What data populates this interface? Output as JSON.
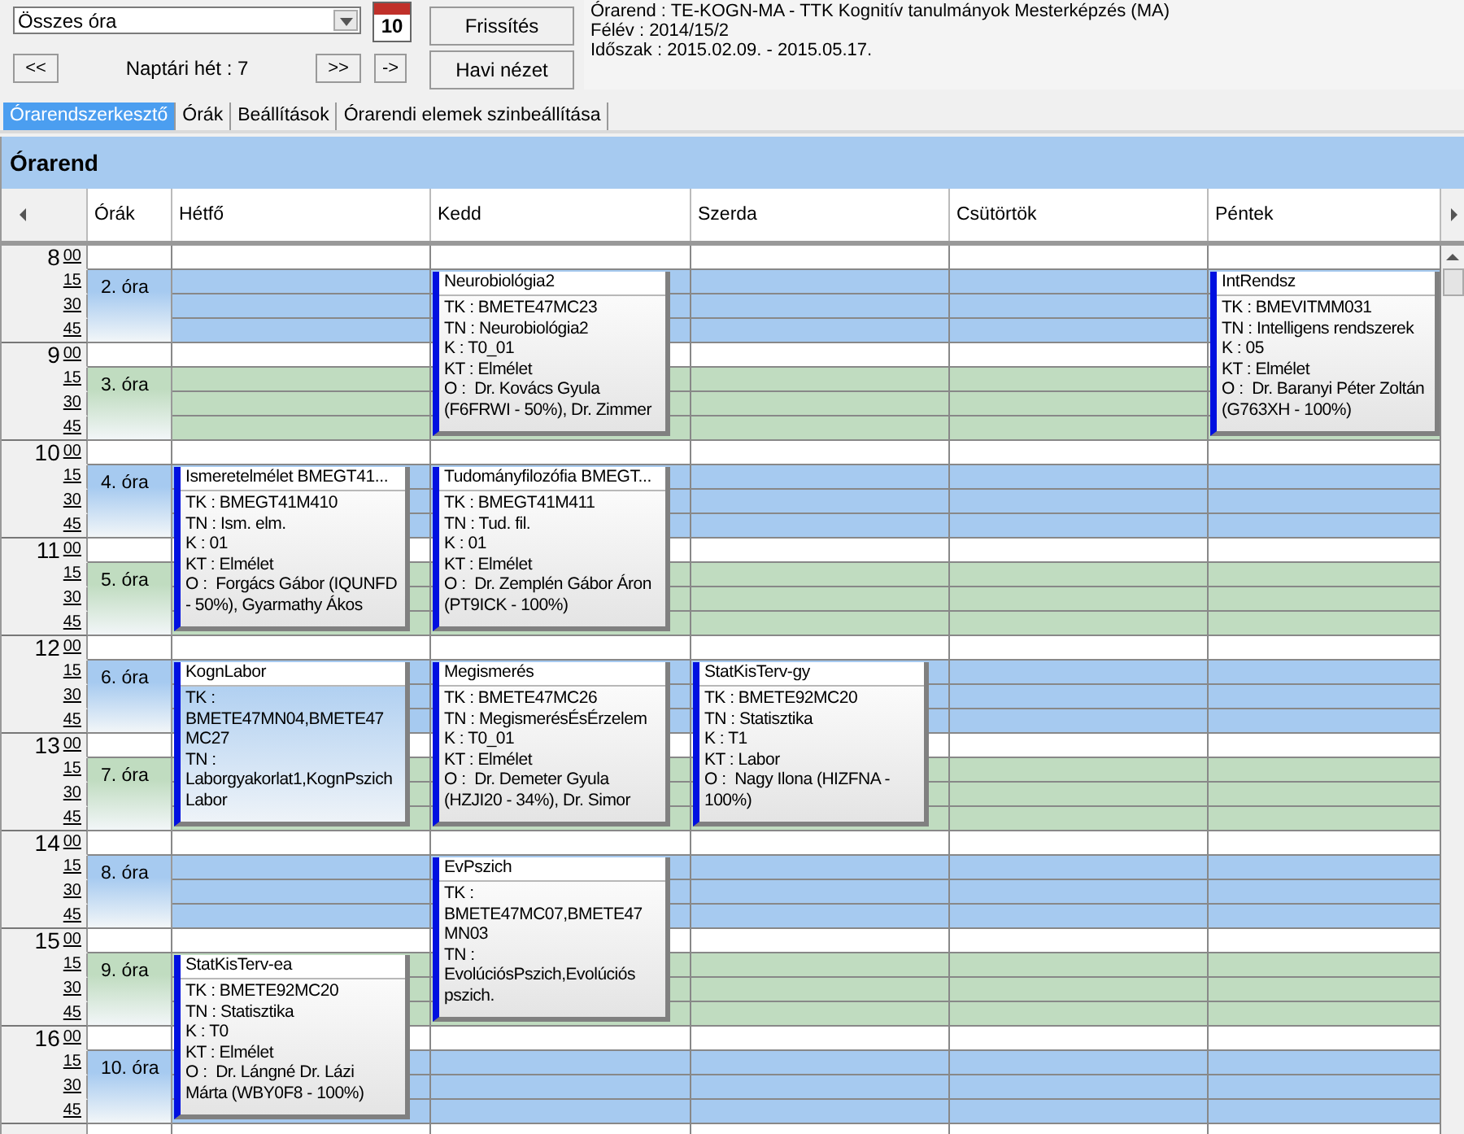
{
  "toolbar": {
    "filter": {
      "value": "Összes óra"
    },
    "calendar_day": "10",
    "prev_button": "<<",
    "week_label": "Naptári hét : 7",
    "next_button": ">>",
    "jump_button": "->",
    "refresh_button": "Frissítés",
    "month_view_button": "Havi nézet"
  },
  "info": [
    "Órarend : TE-KOGN-MA - TTK Kognitív tanulmányok Mesterképzés (MA)",
    "Félév : 2014/15/2",
    "Időszak : 2015.02.09. - 2015.05.17."
  ],
  "tabs": [
    {
      "label": "Órarendszerkesztő",
      "selected": true
    },
    {
      "label": "Órák",
      "selected": false
    },
    {
      "label": "Beállítások",
      "selected": false
    },
    {
      "label": "Órarendi elemek szinbeállítása",
      "selected": false
    }
  ],
  "timetable": {
    "title": "Órarend",
    "period_column": "Órák",
    "hours": [
      {
        "hour": "8",
        "minutes": [
          "00",
          "15",
          "30",
          "45"
        ],
        "period": {
          "label": "2. óra",
          "color": "#a6caf0"
        }
      },
      {
        "hour": "9",
        "minutes": [
          "00",
          "15",
          "30",
          "45"
        ],
        "period": {
          "label": "3. óra",
          "color": "#c0dcc0"
        }
      },
      {
        "hour": "10",
        "minutes": [
          "00",
          "15",
          "30",
          "45"
        ],
        "period": {
          "label": "4. óra",
          "color": "#a6caf0"
        }
      },
      {
        "hour": "11",
        "minutes": [
          "00",
          "15",
          "30",
          "45"
        ],
        "period": {
          "label": "5. óra",
          "color": "#c0dcc0"
        }
      },
      {
        "hour": "12",
        "minutes": [
          "00",
          "15",
          "30",
          "45"
        ],
        "period": {
          "label": "6. óra",
          "color": "#a6caf0"
        }
      },
      {
        "hour": "13",
        "minutes": [
          "00",
          "15",
          "30",
          "45"
        ],
        "period": {
          "label": "7. óra",
          "color": "#c0dcc0"
        }
      },
      {
        "hour": "14",
        "minutes": [
          "00",
          "15",
          "30",
          "45"
        ],
        "period": {
          "label": "8. óra",
          "color": "#a6caf0"
        }
      },
      {
        "hour": "15",
        "minutes": [
          "00",
          "15",
          "30",
          "45"
        ],
        "period": {
          "label": "9. óra",
          "color": "#c0dcc0"
        }
      },
      {
        "hour": "16",
        "minutes": [
          "00",
          "15",
          "30",
          "45"
        ],
        "period": {
          "label": "10. óra",
          "color": "#a6caf0"
        }
      }
    ],
    "days": [
      {
        "name": "Hétfő",
        "slots": [
          {
            "kind": "free"
          },
          {
            "kind": "free"
          },
          {
            "kind": "event",
            "title": "Ismeretelmélet BMEGT41...",
            "selected": false,
            "lines": [
              "TK : BMEGT41M410",
              "TN : Ism. elm.",
              "K : 01",
              "KT : Elmélet",
              "O :  Forgács Gábor (IQUNFD",
              "- 50%), Gyarmathy Ákos"
            ]
          },
          {
            "kind": "free"
          },
          {
            "kind": "event",
            "title": "KognLabor",
            "selected": true,
            "lines": [
              "TK :",
              "BMETE47MN04,BMETE47",
              "MC27",
              "TN :",
              "Laborgyakorlat1,KognPszich",
              "Labor"
            ]
          },
          {
            "kind": "free"
          },
          {
            "kind": "free"
          },
          {
            "kind": "event",
            "title": "StatKisTerv-ea",
            "selected": false,
            "lines": [
              "TK : BMETE92MC20",
              "TN : Statisztika",
              "K : T0",
              "KT : Elmélet",
              "O :  Dr. Lángné Dr. Lázi",
              "Márta (WBY0F8 - 100%)"
            ]
          },
          {
            "kind": "free"
          }
        ]
      },
      {
        "name": "Kedd",
        "slots": [
          {
            "kind": "event",
            "title": "Neurobiológia2",
            "selected": false,
            "lines": [
              "TK : BMETE47MC23",
              "TN : Neurobiológia2",
              "K : T0_01",
              "KT : Elmélet",
              "O :  Dr. Kovács Gyula",
              "(F6FRWI - 50%), Dr. Zimmer"
            ]
          },
          {
            "kind": "free"
          },
          {
            "kind": "event",
            "title": "Tudományfilozófia BMEGT...",
            "selected": false,
            "lines": [
              "TK : BMEGT41M411",
              "TN : Tud. fil.",
              "K : 01",
              "KT : Elmélet",
              "O :  Dr. Zemplén Gábor Áron",
              "(PT9ICK - 100%)"
            ]
          },
          {
            "kind": "free"
          },
          {
            "kind": "event",
            "title": "Megismerés",
            "selected": false,
            "lines": [
              "TK : BMETE47MC26",
              "TN : MegismerésÉsÉrzelem",
              "K : T0_01",
              "KT : Elmélet",
              "O :  Dr. Demeter Gyula",
              "(HZJI20 - 34%), Dr. Simor"
            ]
          },
          {
            "kind": "free"
          },
          {
            "kind": "event",
            "title": "EvPszich",
            "selected": false,
            "lines": [
              "TK :",
              "BMETE47MC07,BMETE47",
              "MN03",
              "TN :",
              "EvolúciósPszich,Evolúciós",
              "pszich."
            ]
          },
          {
            "kind": "free"
          },
          {
            "kind": "free"
          }
        ]
      },
      {
        "name": "Szerda",
        "slots": [
          {
            "kind": "free"
          },
          {
            "kind": "free"
          },
          {
            "kind": "free"
          },
          {
            "kind": "free"
          },
          {
            "kind": "event",
            "title": "StatKisTerv-gy",
            "selected": false,
            "lines": [
              "TK : BMETE92MC20",
              "TN : Statisztika",
              "K : T1",
              "KT : Labor",
              "O :  Nagy Ilona (HIZFNA -",
              "100%)"
            ]
          },
          {
            "kind": "free"
          },
          {
            "kind": "free"
          },
          {
            "kind": "free"
          },
          {
            "kind": "free"
          }
        ]
      },
      {
        "name": "Csütörtök",
        "slots": [
          {
            "kind": "free"
          },
          {
            "kind": "free"
          },
          {
            "kind": "free"
          },
          {
            "kind": "free"
          },
          {
            "kind": "free"
          },
          {
            "kind": "free"
          },
          {
            "kind": "free"
          },
          {
            "kind": "free"
          },
          {
            "kind": "free"
          }
        ]
      },
      {
        "name": "Péntek",
        "slots": [
          {
            "kind": "event",
            "title": "IntRendsz",
            "selected": false,
            "lines": [
              "TK : BMEVITMM031",
              "TN : Intelligens rendszerek",
              "K : 05",
              "KT : Elmélet",
              "O :  Dr. Baranyi Péter Zoltán",
              "(G763XH - 100%)"
            ]
          },
          {
            "kind": "free"
          },
          {
            "kind": "free"
          },
          {
            "kind": "free"
          },
          {
            "kind": "free"
          },
          {
            "kind": "free"
          },
          {
            "kind": "free"
          },
          {
            "kind": "free"
          },
          {
            "kind": "free"
          }
        ]
      }
    ]
  }
}
